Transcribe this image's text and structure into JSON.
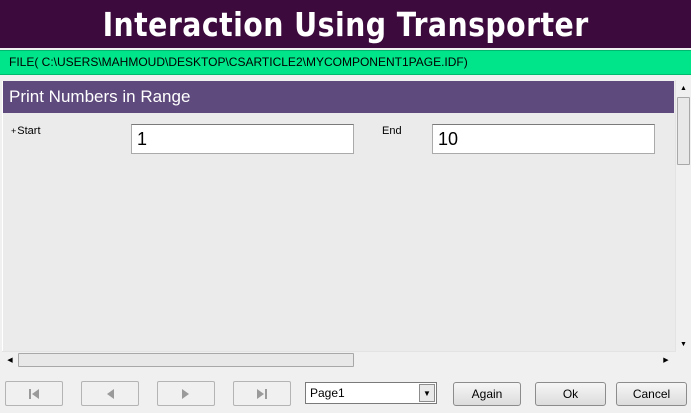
{
  "header": {
    "title": "Interaction Using Transporter"
  },
  "file_bar": {
    "path": "FILE( C:\\USERS\\MAHMOUD\\DESKTOP\\CSARTICLE2\\MYCOMPONENT1PAGE.IDF)"
  },
  "form": {
    "section_title": "Print Numbers in Range",
    "start_label": "Start",
    "start_marker": "+",
    "start_value": "1",
    "end_label": "End",
    "end_value": "10"
  },
  "toolbar": {
    "page_select_value": "Page1",
    "again_label": "Again",
    "ok_label": "Ok",
    "cancel_label": "Cancel"
  },
  "colors": {
    "title_bg": "#3c0a3c",
    "file_bar_bg": "#00e58a",
    "section_header_bg": "#5e4a7c",
    "form_bg": "#ebebeb"
  },
  "icons": {
    "first": "skip-to-start-icon",
    "prev": "triangle-left-icon",
    "next": "triangle-right-icon",
    "last": "skip-to-end-icon"
  }
}
